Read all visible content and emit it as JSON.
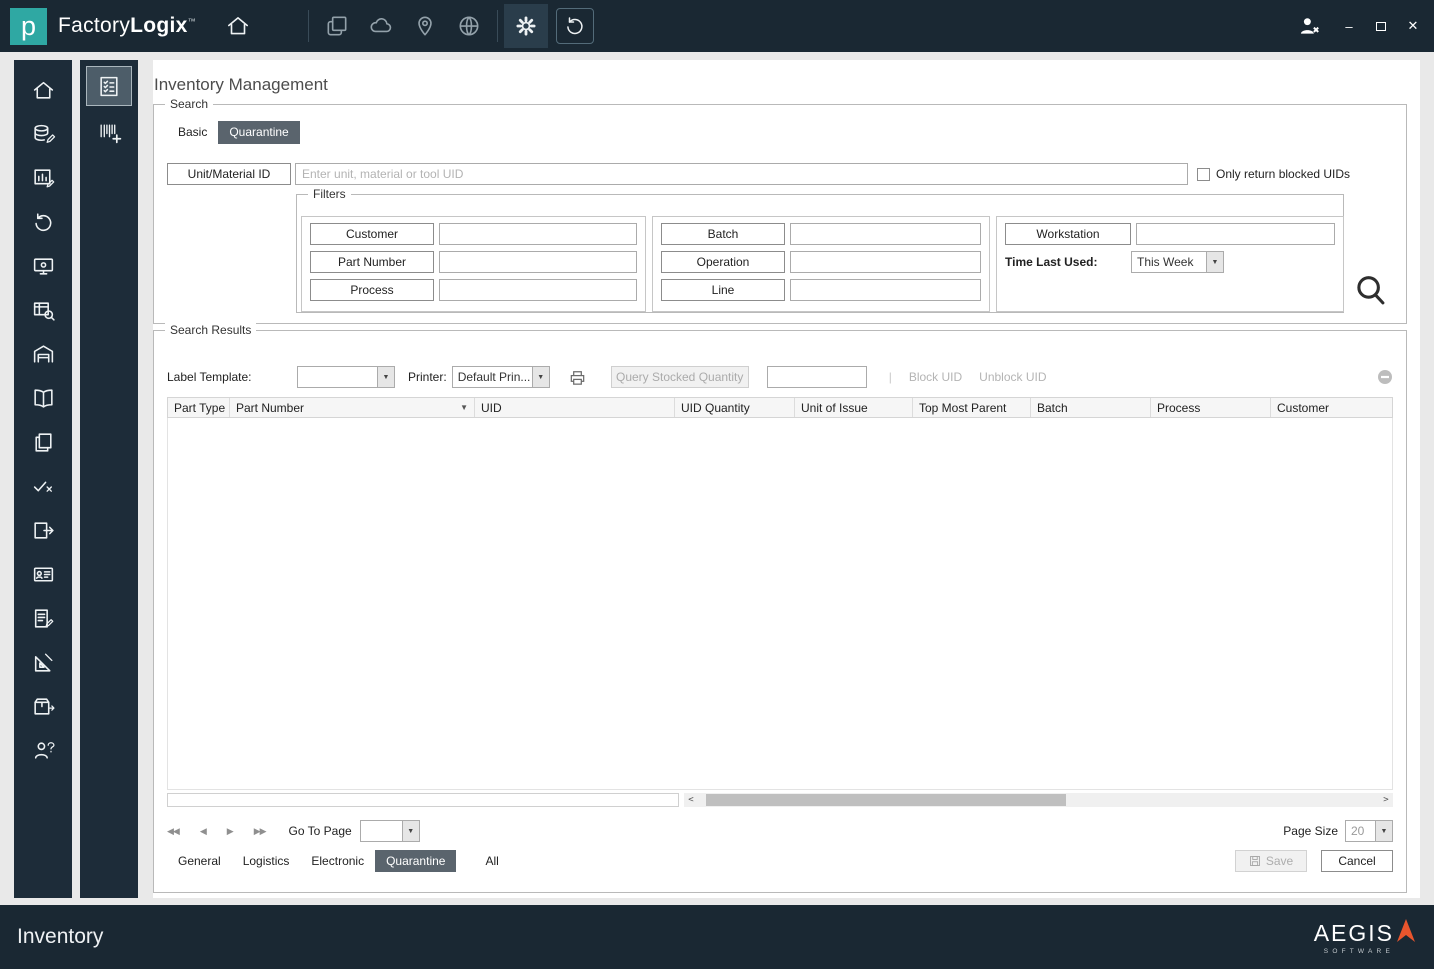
{
  "colors": {
    "titlebar": "#1a2833",
    "accent_teal": "#2fa8a3",
    "selected_tab": "#5a646d",
    "aegis_orange": "#e8552d"
  },
  "titlebar": {
    "logo_letter": "p",
    "brand_regular": "Factory",
    "brand_bold": "Logix",
    "trademark": "™"
  },
  "window": {
    "minimize": "–",
    "close": "✕"
  },
  "page": {
    "title": "Inventory Management"
  },
  "search": {
    "legend": "Search",
    "tabs": [
      {
        "label": "Basic"
      },
      {
        "label": "Quarantine"
      }
    ],
    "unit_button": "Unit/Material ID",
    "unit_placeholder": "Enter unit, material or tool UID",
    "blocked_label": "Only return blocked UIDs",
    "filters": {
      "legend": "Filters",
      "left_buttons": [
        "Customer",
        "Part Number",
        "Process"
      ],
      "mid_buttons": [
        "Batch",
        "Operation",
        "Line"
      ],
      "workstation_button": "Workstation",
      "time_label": "Time Last Used:",
      "time_value": "This Week"
    }
  },
  "results": {
    "legend": "Search Results",
    "label_template": "Label Template:",
    "printer": "Printer:",
    "printer_value": "Default Prin...",
    "query_button": "Query Stocked Quantity",
    "separator": "|",
    "block_uid": "Block UID",
    "unblock_uid": "Unblock UID",
    "columns": [
      "Part Type",
      "Part Number",
      "UID",
      "UID Quantity",
      "Unit of Issue",
      "Top Most Parent",
      "Batch",
      "Process",
      "Customer"
    ],
    "rows": []
  },
  "pagination": {
    "first": "◀◀",
    "prev": "◀",
    "next": "▶",
    "last": "▶▶",
    "go_to_page": "Go To Page",
    "page_size_label": "Page Size",
    "page_size_value": "20"
  },
  "bottom_tabs": [
    "General",
    "Logistics",
    "Electronic",
    "Quarantine",
    "All"
  ],
  "actions": {
    "save": "Save",
    "cancel": "Cancel"
  },
  "statusbar": {
    "title": "Inventory",
    "brand": "AEGIS",
    "brand_sub": "SOFTWARE"
  },
  "glyphs": {
    "dropdown": "▼",
    "sort": "▼",
    "scroll_left": "<",
    "scroll_right": ">"
  },
  "icons": {
    "titlebar": [
      "home-icon",
      "layers-icon",
      "cloud-icon",
      "map-pin-icon",
      "globe-icon",
      "gear-icon",
      "history-icon",
      "user-signout-icon"
    ],
    "sidebar": [
      "home-icon",
      "database-edit-icon",
      "clipboard-chart-icon",
      "history-icon",
      "monitor-icon",
      "table-search-icon",
      "warehouse-icon",
      "book-icon",
      "copy-pages-icon",
      "check-x-icon",
      "export-icon",
      "id-card-icon",
      "note-edit-icon",
      "ruler-pencil-icon",
      "package-icon",
      "person-question-icon"
    ],
    "sidebar2": [
      "checklist-icon",
      "barcode-add-icon"
    ]
  }
}
